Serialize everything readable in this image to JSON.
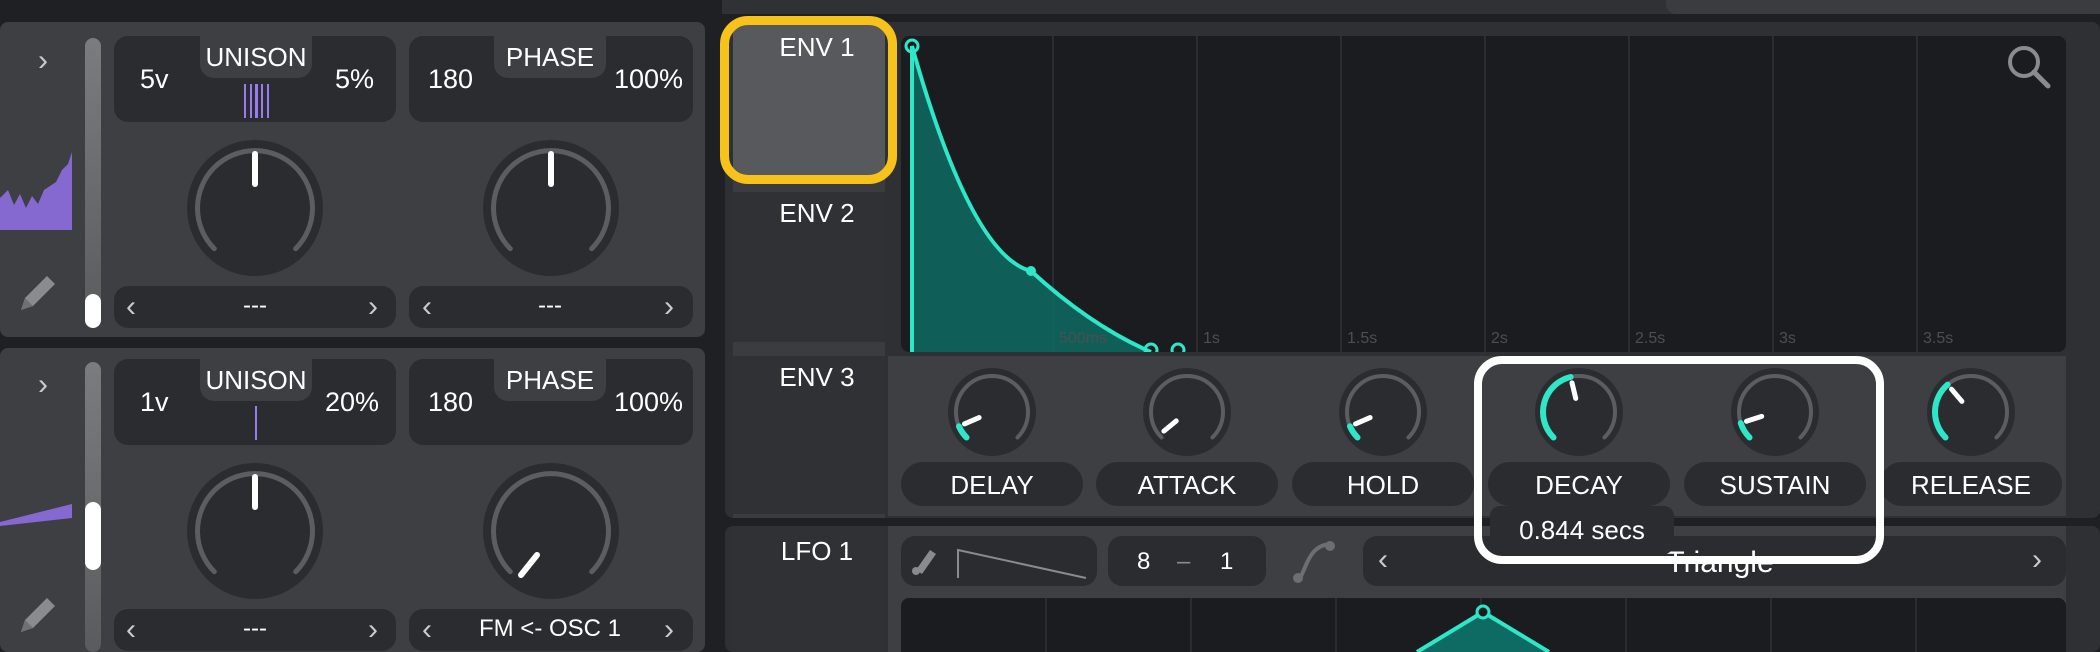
{
  "osc1": {
    "unison_voices": "5v",
    "unison_label": "UNISON",
    "unison_detune": "5%",
    "phase_value": "180",
    "phase_label": "PHASE",
    "phase_random": "100%",
    "left_select": "---",
    "right_select": "---"
  },
  "osc2": {
    "unison_voices": "1v",
    "unison_label": "UNISON",
    "unison_detune": "20%",
    "phase_value": "180",
    "phase_label": "PHASE",
    "phase_random": "100%",
    "left_select": "---",
    "right_select": "FM <- OSC 1"
  },
  "env_tabs": [
    {
      "label": "ENV 1",
      "selected": true
    },
    {
      "label": "ENV 2",
      "selected": false
    },
    {
      "label": "ENV 3",
      "selected": false
    }
  ],
  "lfo_tab": {
    "label": "LFO 1"
  },
  "env_graph": {
    "time_labels": [
      "500ms",
      "1s",
      "1.5s",
      "2s",
      "2.5s",
      "3s",
      "3.5s"
    ]
  },
  "env_knobs": [
    {
      "label": "DELAY",
      "level": 0.08
    },
    {
      "label": "ATTACK",
      "level": 0.02
    },
    {
      "label": "HOLD",
      "level": 0.08
    },
    {
      "label": "DECAY",
      "level": 0.45
    },
    {
      "label": "SUSTAIN",
      "level": 0.1
    },
    {
      "label": "RELEASE",
      "level": 0.35
    }
  ],
  "tooltip": {
    "text": "0.844 secs"
  },
  "lfo": {
    "rate_numerator": "8",
    "rate_separator": "–",
    "rate_denominator": "1",
    "shape_name": "Triangle"
  },
  "colors": {
    "accent": "#2ee6c8",
    "unison_voice": "#9b7cf0",
    "highlight_yellow": "#f7c21a",
    "highlight_white": "#ffffff"
  }
}
